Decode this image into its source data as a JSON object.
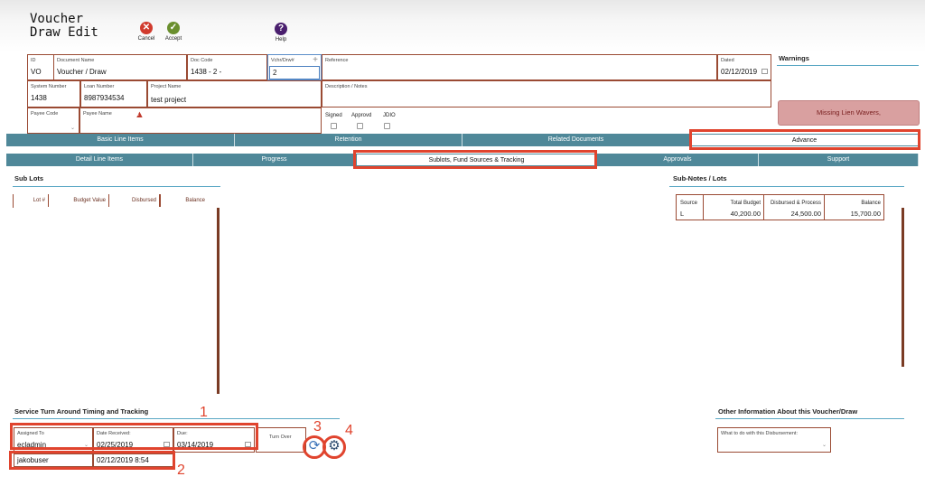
{
  "header": {
    "title_line1": "Voucher",
    "title_line2": "Draw Edit",
    "cancel_label": "Cancel",
    "accept_label": "Accept",
    "help_label": "Help"
  },
  "form": {
    "id": {
      "label": "ID",
      "value": "VO"
    },
    "doc_name": {
      "label": "Document Name",
      "value": "Voucher / Draw"
    },
    "doc_code": {
      "label": "Doc Code",
      "value": "1438 - 2 -"
    },
    "vchr": {
      "label": "Vchr/Drw#",
      "value": "2"
    },
    "reference": {
      "label": "Reference"
    },
    "dated": {
      "label": "Dated",
      "value": "02/12/2019"
    },
    "system_number": {
      "label": "System Number",
      "value": "1438"
    },
    "loan_number": {
      "label": "Loan Number",
      "value": "8987934534"
    },
    "project_name": {
      "label": "Project Name",
      "value": "test project"
    },
    "description": {
      "label": "Description / Notes"
    },
    "payee_code": {
      "label": "Payee Code"
    },
    "payee_name": {
      "label": "Payee Name"
    },
    "signed": "Signed",
    "approvd": "Approvd",
    "jdio": "JDIO"
  },
  "warnings": {
    "title": "Warnings",
    "message": "Missing Lien Wavers,"
  },
  "tabs1": [
    "Basic Line Items",
    "Retention",
    "Related Documents",
    "Advance"
  ],
  "tabs2": [
    "Detail Line Items",
    "Progress",
    "Sublots, Fund Sources & Tracking",
    "Approvals",
    "Support"
  ],
  "sublots": {
    "title": "Sub Lots",
    "columns": [
      "Lot #",
      "Budget Value",
      "Disbursed",
      "Balance"
    ]
  },
  "subnotes": {
    "title": "Sub-Notes / Lots",
    "columns": [
      "Source",
      "Total Budget",
      "Disbursed & Process",
      "Balance"
    ],
    "row": [
      "L",
      "40,200.00",
      "24,500.00",
      "15,700.00"
    ]
  },
  "service": {
    "title": "Service Turn Around Timing and Tracking",
    "assigned_to": {
      "label": "Assigned To",
      "value": "ecladmin"
    },
    "date_received": {
      "label": "Date Received:",
      "value": "02/25/2019"
    },
    "due": {
      "label": "Due:",
      "value": "03/14/2019"
    },
    "turn_over": "Turn Over",
    "user": "jakobuser",
    "timestamp": "02/12/2019 8:54"
  },
  "other_info": {
    "title": "Other Information About this Voucher/Draw",
    "field_label": "What to do with this Disbursement:"
  },
  "annotations": [
    "1",
    "2",
    "3",
    "4"
  ],
  "colors": {
    "tab_bg": "#4f8899",
    "accent_red": "#e0442e",
    "field_border": "#9a4a33",
    "warning_bg": "#d9a0a0"
  }
}
